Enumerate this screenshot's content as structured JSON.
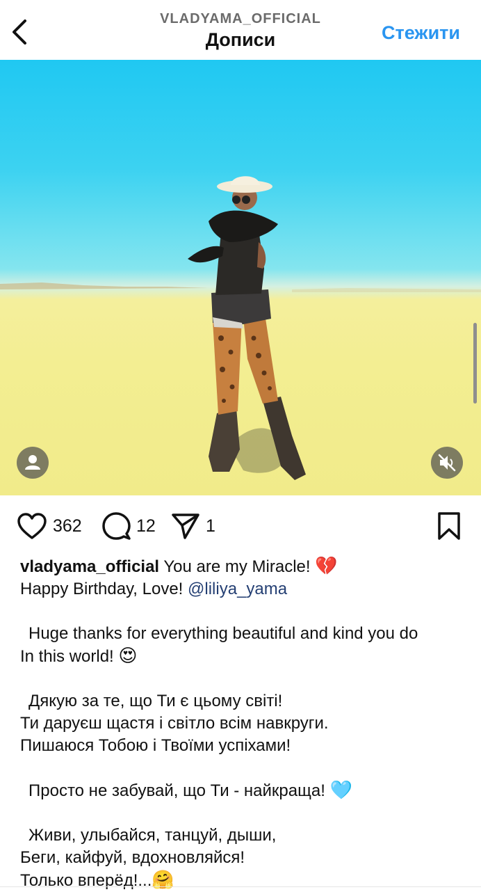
{
  "header": {
    "username": "VLADYAMA_OFFICIAL",
    "title": "Дописи",
    "follow_label": "Стежити",
    "back_icon": "chevron-left-icon"
  },
  "photo": {
    "description_icons": [
      "user-tag-icon",
      "muted-speaker-icon"
    ],
    "sky_color": "#20c8f2",
    "sand_color": "#f3ee92"
  },
  "actions": {
    "likes": "362",
    "comments": "12",
    "shares": "1"
  },
  "caption": {
    "username": "vladyama_official",
    "line1": " You are my Miracle! ",
    "emoji1": "💔",
    "line2": "Happy Birthday, Love! ",
    "mention": "@liliya_yama",
    "line3": "Huge thanks for everything beautiful and kind you do",
    "line4": "In this world! ",
    "emoji2": "😍",
    "line5": "Дякую за те, що Ти є цьому світі!",
    "line6": "Ти даруєш щастя і світло всім навкруги.",
    "line7": "Пишаюся Тобою і Твоїми успіхами!",
    "line8": "Просто не забувай, що Ти - найкраща! ",
    "emoji3": "🩵",
    "line9": "Живи, улыбайся, танцуй, дыши,",
    "line10": "Беги, кайфуй, вдохновляйся!",
    "line11": "Только вперёд!...",
    "emoji4": "🤗"
  },
  "colors": {
    "accent": "#2a95f0",
    "mention": "#243f73"
  }
}
